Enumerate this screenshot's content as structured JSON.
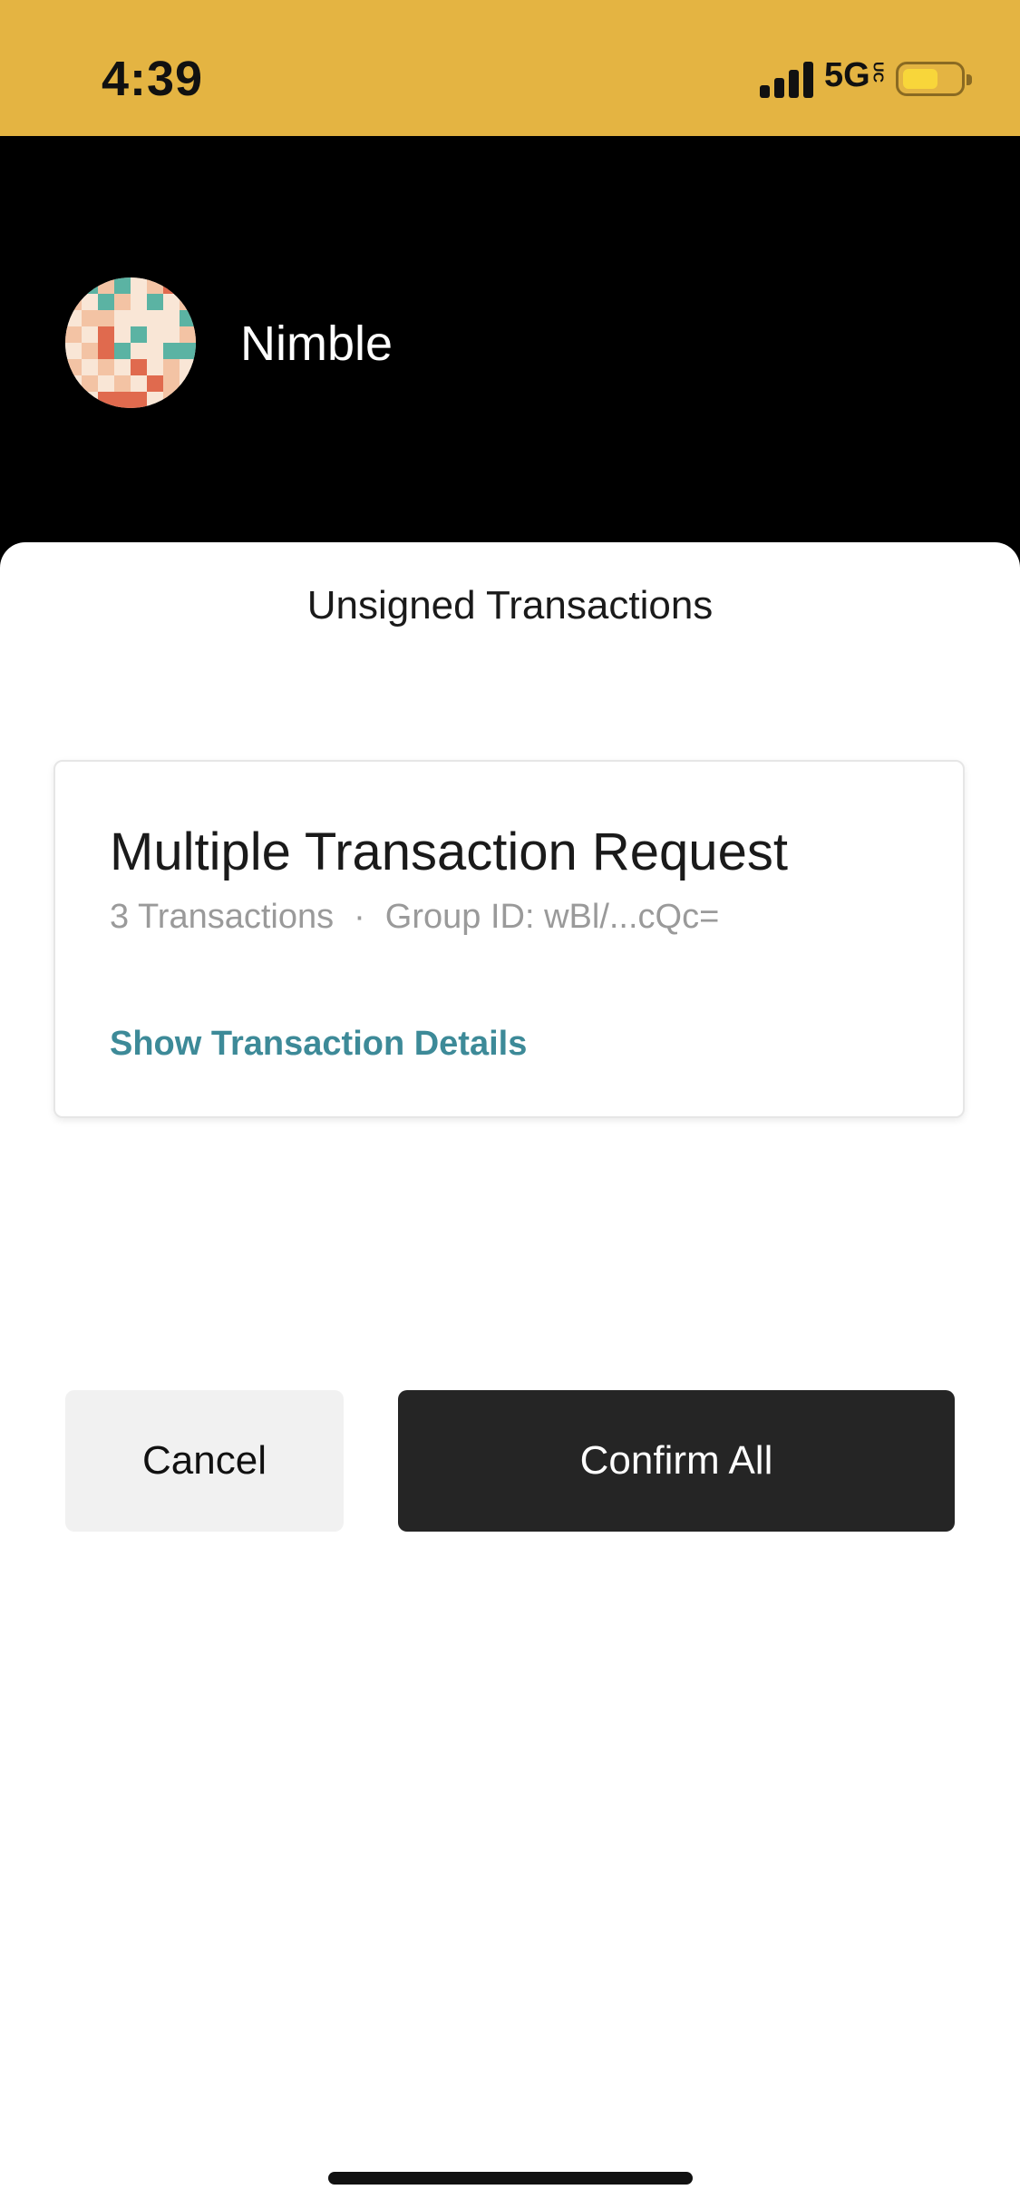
{
  "status_bar": {
    "time": "4:39",
    "network": "5G",
    "network_sub": "UC",
    "background": "#E4B442"
  },
  "header": {
    "app_name": "Nimble",
    "avatar_icon": "pixel-identicon"
  },
  "sheet": {
    "title": "Unsigned Transactions",
    "card": {
      "title": "Multiple Transaction Request",
      "transactions": "3 Transactions",
      "separator": "·",
      "group_id": "Group ID: wBl/...cQc=",
      "details_link": "Show Transaction Details"
    }
  },
  "actions": {
    "cancel_label": "Cancel",
    "confirm_label": "Confirm All"
  },
  "colors": {
    "accent_link": "#3D8A98",
    "confirm_bg": "#252525",
    "cancel_bg": "#F1F1F1"
  }
}
